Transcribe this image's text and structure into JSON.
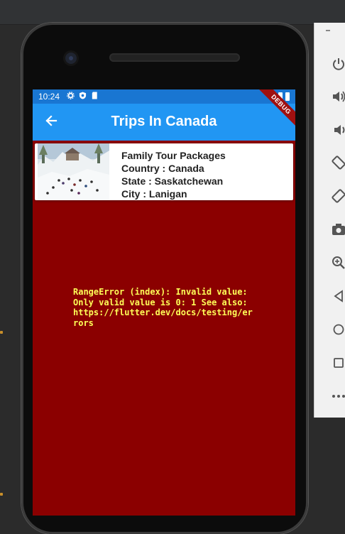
{
  "emulator": {
    "controls": [
      "power-icon",
      "volume-up-icon",
      "volume-down-icon",
      "rotate-left-icon",
      "rotate-right-icon",
      "camera-icon",
      "zoom-icon",
      "back-icon",
      "home-icon",
      "overview-icon",
      "more-icon"
    ]
  },
  "statusbar": {
    "time": "10:24"
  },
  "appbar": {
    "title": "Trips In Canada",
    "color": "#2196f3"
  },
  "debug_banner": "DEBUG",
  "trip": {
    "title": "Family Tour Packages",
    "country": "Country : Canada",
    "state": "State : Saskatchewan",
    "city": "City : Lanigan"
  },
  "error": {
    "text": "RangeError (index): Invalid value: Only valid value is 0: 1 See also: https://flutter.dev/docs/testing/errors",
    "background": "#8b0000",
    "color": "#ffff57"
  }
}
